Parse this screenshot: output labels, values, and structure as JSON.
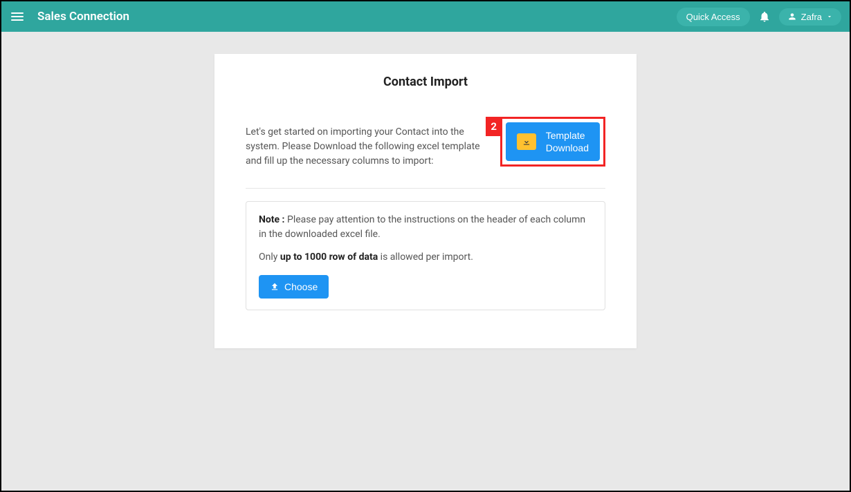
{
  "header": {
    "app_title": "Sales Connection",
    "quick_access_label": "Quick Access",
    "user_name": "Zafra"
  },
  "card": {
    "title": "Contact Import",
    "intro_line1": "Let's get started on importing your Contact into the system.",
    "intro_line2": "Please Download the following excel template and fill up the necessary columns to import:",
    "callout_number": "2",
    "template_btn_line1": "Template",
    "template_btn_line2": "Download",
    "note_label": "Note :",
    "note_text": " Please pay attention to the instructions on the header of each column in the downloaded excel file.",
    "limit_prefix": "Only ",
    "limit_bold": "up to 1000 row of data",
    "limit_suffix": " is allowed per import.",
    "choose_label": "Choose"
  }
}
